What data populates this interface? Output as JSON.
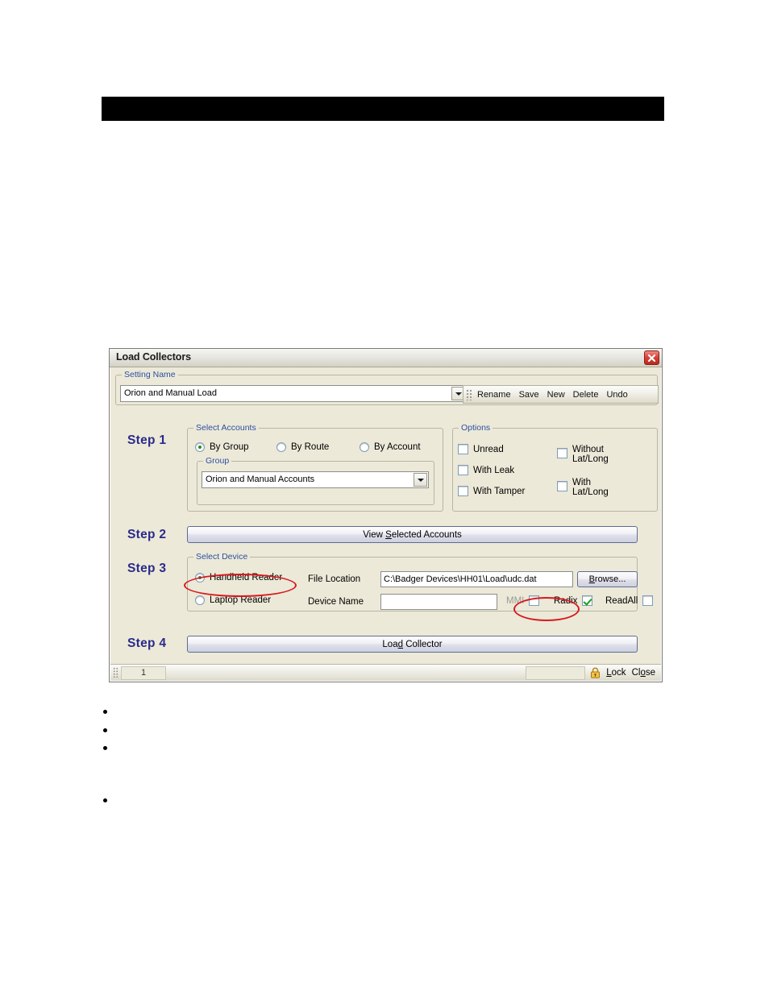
{
  "document": {
    "black_bar": {
      "text": "",
      "color": "#000000"
    },
    "bullets": [
      {
        "text": ""
      },
      {
        "text": ""
      },
      {
        "text": ""
      },
      {
        "text": ""
      }
    ]
  },
  "dialog": {
    "title": "Load Collectors",
    "close_icon": "close-icon",
    "setting_name": {
      "legend": "Setting Name",
      "value": "Orion and Manual Load",
      "dropdown_icon": "chevron-down-icon"
    },
    "toolbar": {
      "grip_icon": "drag-grip-icon",
      "buttons": [
        {
          "label": "Rename"
        },
        {
          "label": "Save"
        },
        {
          "label": "New"
        },
        {
          "label": "Delete"
        },
        {
          "label": "Undo"
        }
      ]
    },
    "step1": {
      "label": "Step 1",
      "select_accounts": {
        "legend": "Select Accounts",
        "radios": [
          {
            "label": "By Group",
            "checked": true
          },
          {
            "label": "By Route",
            "checked": false
          },
          {
            "label": "By Account",
            "checked": false
          }
        ],
        "group": {
          "legend": "Group",
          "value": "Orion and Manual Accounts",
          "dropdown_icon": "chevron-down-icon"
        }
      },
      "options": {
        "legend": "Options",
        "left_column": [
          {
            "label": "Unread",
            "checked": false
          },
          {
            "label": "With Leak",
            "checked": false
          },
          {
            "label": "With Tamper",
            "checked": false
          }
        ],
        "right_column": [
          {
            "label": "Without\nLat/Long",
            "line1": "Without",
            "line2": "Lat/Long",
            "checked": false
          },
          {
            "label": "With\nLat/Long",
            "line1": "With",
            "line2": "Lat/Long",
            "checked": false
          }
        ]
      }
    },
    "step2": {
      "label": "Step 2",
      "button": {
        "before": "View ",
        "accel": "S",
        "after": "elected Accounts"
      }
    },
    "step3": {
      "label": "Step 3",
      "select_device": {
        "legend": "Select Device",
        "radios": [
          {
            "label": "Handheld Reader",
            "checked": true
          },
          {
            "label": "Laptop Reader",
            "checked": false
          }
        ],
        "file_location_label": "File Location",
        "file_location_value": "C:\\Badger Devices\\HH01\\Load\\udc.dat",
        "browse_button": {
          "accel": "B",
          "after": "rowse..."
        },
        "device_name_label": "Device Name",
        "device_name_value": "",
        "mmi": {
          "label": "MMI",
          "checked": false,
          "disabled": true
        },
        "radix": {
          "label": "Radix",
          "checked": true
        },
        "readall": {
          "label": "ReadAll",
          "checked": false
        }
      }
    },
    "step4": {
      "label": "Step 4",
      "button": {
        "before": "Loa",
        "accel": "d",
        "after": " Collector"
      }
    },
    "statusbar": {
      "grip_icon": "resize-grip-icon",
      "page_number": "1",
      "spacer": "",
      "lock_icon": "padlock-icon",
      "lock": {
        "accel": "L",
        "after": "ock"
      },
      "close": {
        "before": "Cl",
        "accel": "o",
        "after": "se"
      }
    }
  },
  "annotations": {
    "color": "#d71920",
    "ellipses": [
      {
        "name": "handheld-reader-highlight"
      },
      {
        "name": "radix-checkbox-highlight"
      }
    ]
  }
}
